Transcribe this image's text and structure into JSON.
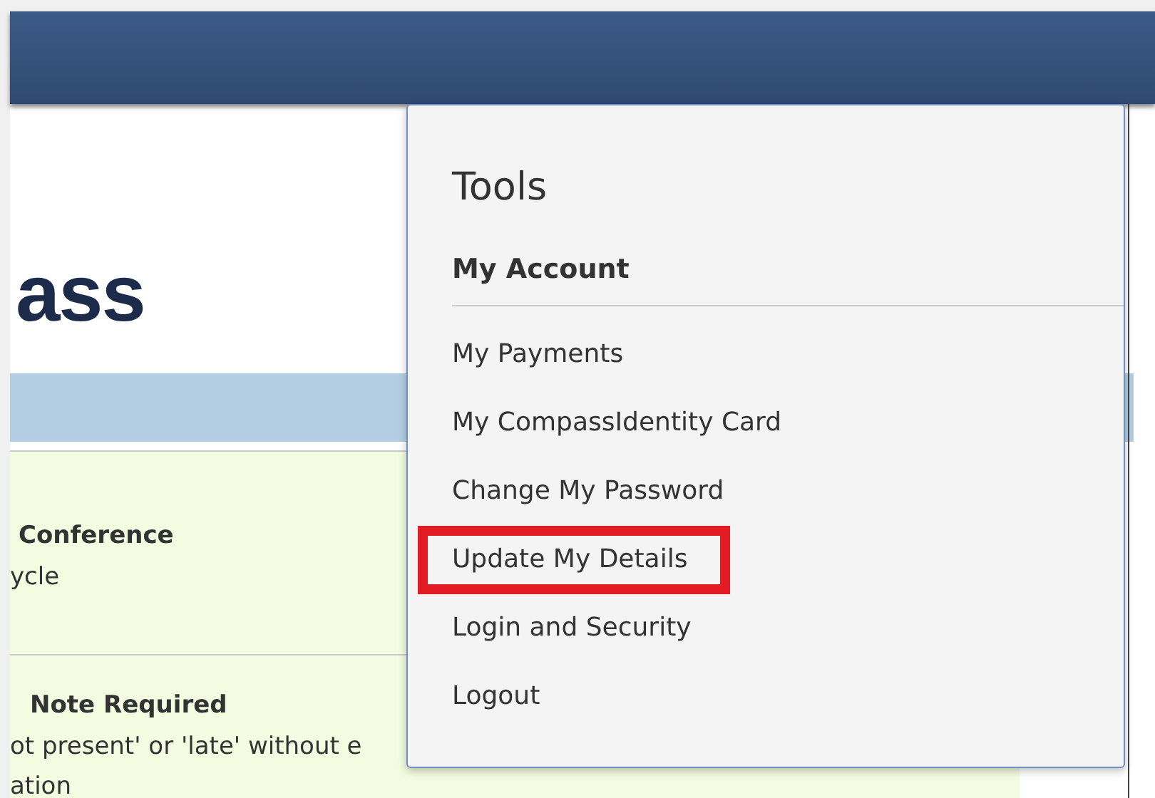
{
  "logo": {
    "text": "ass"
  },
  "notices": [
    {
      "title": "Conference",
      "detail": [
        "ycle"
      ]
    },
    {
      "title": "Note Required",
      "detail": [
        "ot present' or 'late' without e",
        "ation"
      ]
    }
  ],
  "menu": {
    "title": "Tools",
    "section": "My Account",
    "items": [
      {
        "label": "My Payments",
        "highlighted": false
      },
      {
        "label": "My CompassIdentity Card",
        "highlighted": false
      },
      {
        "label": "Change My Password",
        "highlighted": false
      },
      {
        "label": "Update My Details",
        "highlighted": true
      },
      {
        "label": "Login and Security",
        "highlighted": false
      },
      {
        "label": "Logout",
        "highlighted": false
      }
    ]
  }
}
